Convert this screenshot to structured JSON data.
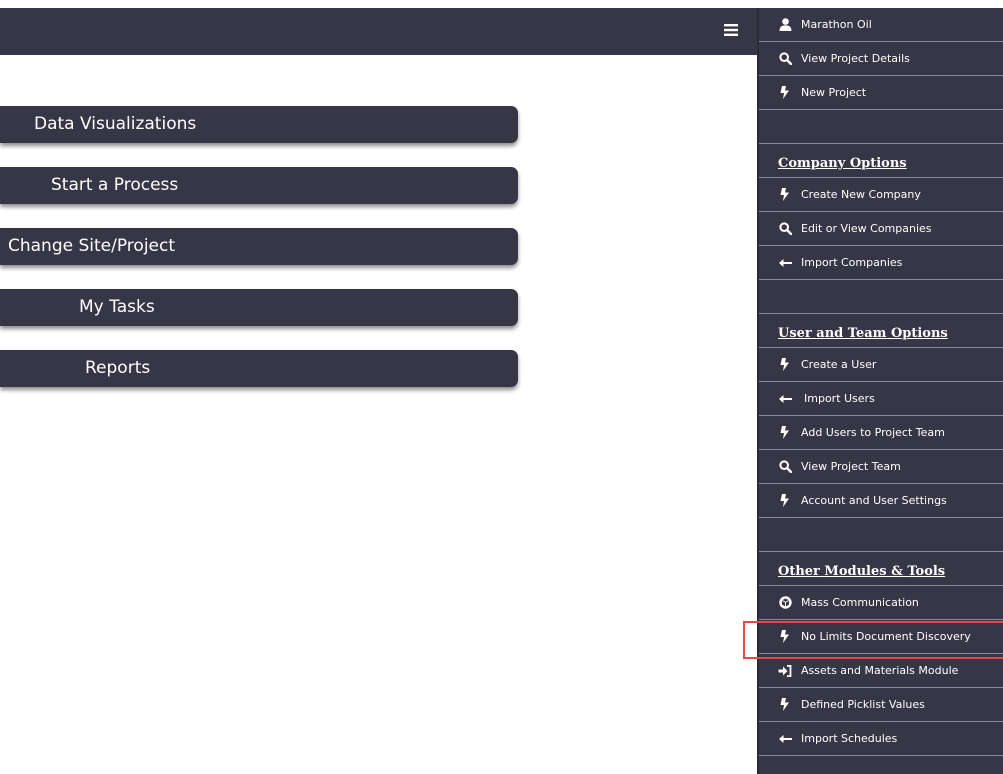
{
  "main": {
    "buttons": [
      {
        "label": "Data Visualizations"
      },
      {
        "label": "Start a Process"
      },
      {
        "label": "Change Site/Project"
      },
      {
        "label": "My Tasks"
      },
      {
        "label": "Reports"
      }
    ]
  },
  "sidebar": {
    "user": {
      "label": "Marathon Oil",
      "icon": "user-icon"
    },
    "view_project_details": {
      "label": "View Project Details",
      "icon": "search-icon"
    },
    "new_project": {
      "label": "New Project",
      "icon": "bolt-icon"
    },
    "company_header": "Company Options",
    "create_company": {
      "label": "Create New Company",
      "icon": "bolt-icon"
    },
    "edit_companies": {
      "label": "Edit or View Companies",
      "icon": "search-icon"
    },
    "import_companies": {
      "label": "Import Companies",
      "icon": "arrow-left-icon"
    },
    "user_team_header": "User and Team Options",
    "create_user": {
      "label": "Create a User",
      "icon": "bolt-icon"
    },
    "import_users": {
      "label": "Import Users",
      "icon": "arrow-left-icon"
    },
    "add_users_team": {
      "label": "Add Users to Project Team",
      "icon": "bolt-icon"
    },
    "view_project_team": {
      "label": "View Project Team",
      "icon": "search-icon"
    },
    "account_settings": {
      "label": "Account and User Settings",
      "icon": "bolt-icon"
    },
    "other_header": "Other Modules & Tools",
    "mass_communication": {
      "label": "Mass Communication",
      "icon": "cube-icon"
    },
    "no_limits": {
      "label": "No Limits Document Discovery",
      "icon": "bolt-icon"
    },
    "assets_materials": {
      "label": "Assets and Materials Module",
      "icon": "sign-in-icon"
    },
    "picklist_values": {
      "label": "Defined Picklist Values",
      "icon": "bolt-icon"
    },
    "import_schedules": {
      "label": "Import Schedules",
      "icon": "arrow-left-icon"
    }
  },
  "colors": {
    "nav_background": "#363647",
    "highlight_border": "#e34848",
    "row_divider": "#8a8a98"
  }
}
